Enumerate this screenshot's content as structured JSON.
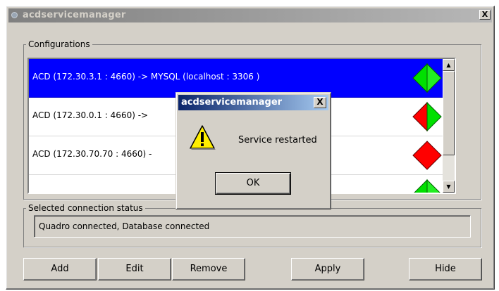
{
  "window": {
    "title": "acdservicemanager",
    "close_label": "X"
  },
  "configurations": {
    "legend": "Configurations",
    "items": [
      {
        "label": "ACD (172.30.3.1 : 4660) -> MYSQL (localhost : 3306 )",
        "status": "running",
        "selected": true
      },
      {
        "label": "ACD (172.30.0.1 : 4660) ->",
        "status": "partial",
        "selected": false
      },
      {
        "label": "ACD (172.30.70.70 : 4660) -",
        "label_tail": ")",
        "status": "stopped",
        "selected": false
      },
      {
        "label": "",
        "status": "running",
        "selected": false
      }
    ]
  },
  "status_group": {
    "legend": "Selected connection status",
    "value": "Quadro connected, Database connected"
  },
  "buttons": {
    "add": "Add",
    "edit": "Edit",
    "remove": "Remove",
    "apply": "Apply",
    "hide": "Hide"
  },
  "dialog": {
    "title": "acdservicemanager",
    "close_label": "X",
    "icon": "warning-icon",
    "message": "Service restarted",
    "ok_label": "OK"
  },
  "colors": {
    "selection": "#0000ff",
    "status_green": "#00e000",
    "status_red": "#ff0000",
    "dialog_title": "#0a246a"
  }
}
